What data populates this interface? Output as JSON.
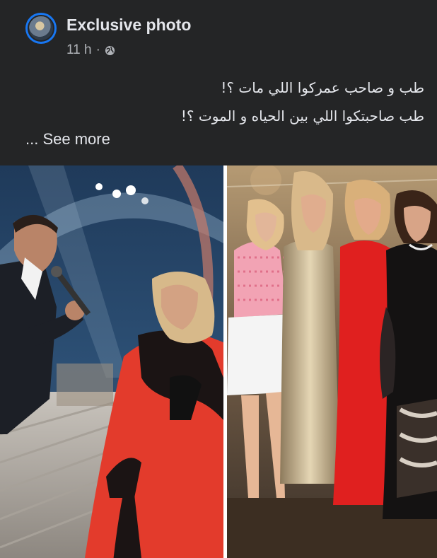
{
  "post": {
    "page_name": "Exclusive photo",
    "timestamp": "11 h",
    "separator": "·",
    "audience_icon": "globe-icon",
    "text_line_1": "طب و صاحب عمركوا اللي مات ؟!",
    "text_line_2": "طب صاحبتكوا اللي بين الحياه و الموت ؟!",
    "see_more": "... See more"
  },
  "photos": [
    {
      "description_icon": "photo-singer-on-stage"
    },
    {
      "description_icon": "photo-four-women-posing"
    }
  ],
  "colors": {
    "background": "#242526",
    "text": "#e4e6eb",
    "secondary_text": "#b0b3b8",
    "accent": "#1877f2"
  }
}
